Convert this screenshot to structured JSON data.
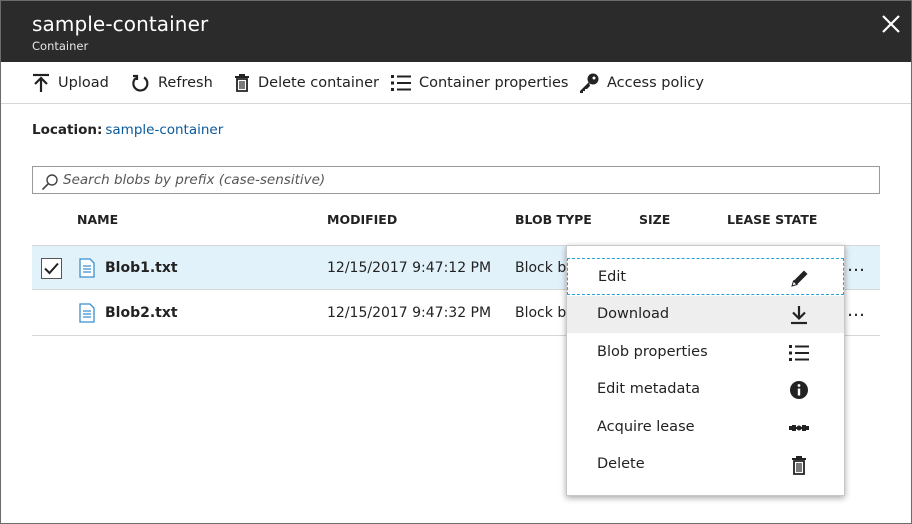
{
  "header": {
    "title": "sample-container",
    "subtitle": "Container"
  },
  "toolbar": {
    "upload": "Upload",
    "refresh": "Refresh",
    "delete_container": "Delete container",
    "container_properties": "Container properties",
    "access_policy": "Access policy"
  },
  "location": {
    "label": "Location:",
    "value": "sample-container"
  },
  "search": {
    "placeholder": "Search blobs by prefix (case-sensitive)"
  },
  "table": {
    "columns": [
      "NAME",
      "MODIFIED",
      "BLOB TYPE",
      "SIZE",
      "LEASE STATE"
    ],
    "rows": [
      {
        "name": "Blob1.txt",
        "modified": "12/15/2017 9:47:12 PM",
        "blob_type": "Block bl",
        "selected": true
      },
      {
        "name": "Blob2.txt",
        "modified": "12/15/2017 9:47:32 PM",
        "blob_type": "Block bl",
        "selected": false
      }
    ],
    "more": "…"
  },
  "context_menu": {
    "items": [
      {
        "label": "Edit",
        "icon": "pencil-icon"
      },
      {
        "label": "Download",
        "icon": "download-icon"
      },
      {
        "label": "Blob properties",
        "icon": "list-icon"
      },
      {
        "label": "Edit metadata",
        "icon": "info-icon"
      },
      {
        "label": "Acquire lease",
        "icon": "lease-icon"
      },
      {
        "label": "Delete",
        "icon": "trash-icon"
      }
    ]
  },
  "colors": {
    "header_bg": "#2b2b2b",
    "link": "#0a5a9c",
    "selected_row": "#e2f2fb",
    "focus_border": "#2a9fd6"
  }
}
